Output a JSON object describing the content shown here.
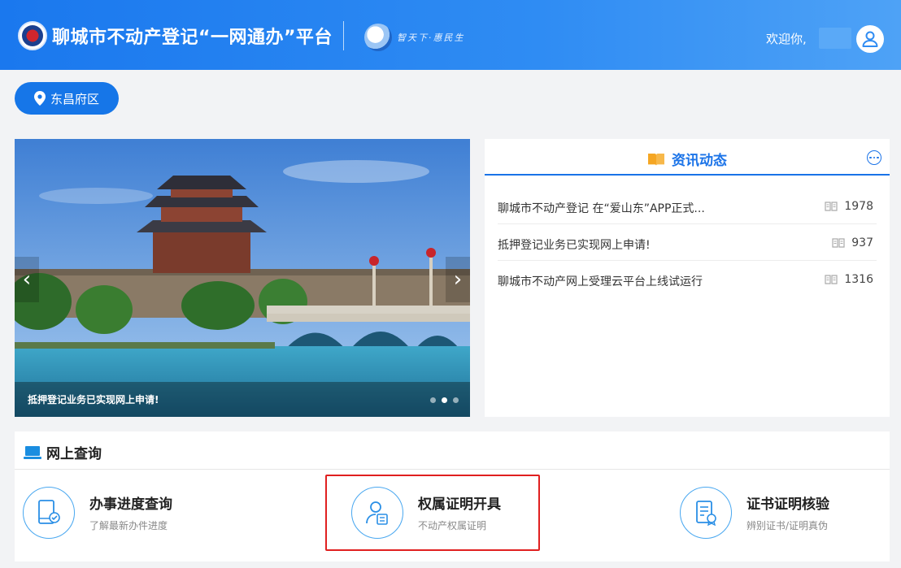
{
  "header": {
    "site_title": "聊城市不动产登记“一网通办”平台",
    "slogan": "智天下·惠民生",
    "welcome_text": "欢迎你,",
    "brand_color": "#1a78ee"
  },
  "region": {
    "label": "东昌府区"
  },
  "carousel": {
    "caption": "抵押登记业务已实现网上申请!",
    "prev_icon": "‹",
    "next_icon": "›",
    "slide_count": 3,
    "active_slide": 2
  },
  "news": {
    "title": "资讯动态",
    "items": [
      {
        "title": "聊城市不动产登记 在“爱山东”APP正式...",
        "views": "1978"
      },
      {
        "title": "抵押登记业务已实现网上申请!",
        "views": "937"
      },
      {
        "title": "聊城市不动产网上受理云平台上线试运行",
        "views": "1316"
      }
    ]
  },
  "query": {
    "title": "网上查询",
    "services": [
      {
        "name": "办事进度查询",
        "desc": "了解最新办件进度",
        "icon": "phone-check-icon"
      },
      {
        "name": "权属证明开具",
        "desc": "不动产权属证明",
        "icon": "person-document-icon"
      },
      {
        "name": "证书证明核验",
        "desc": "辨别证书/证明真伪",
        "icon": "certificate-verify-icon"
      }
    ]
  },
  "colors": {
    "accent": "#1a73e8",
    "highlight": "#e02020"
  }
}
